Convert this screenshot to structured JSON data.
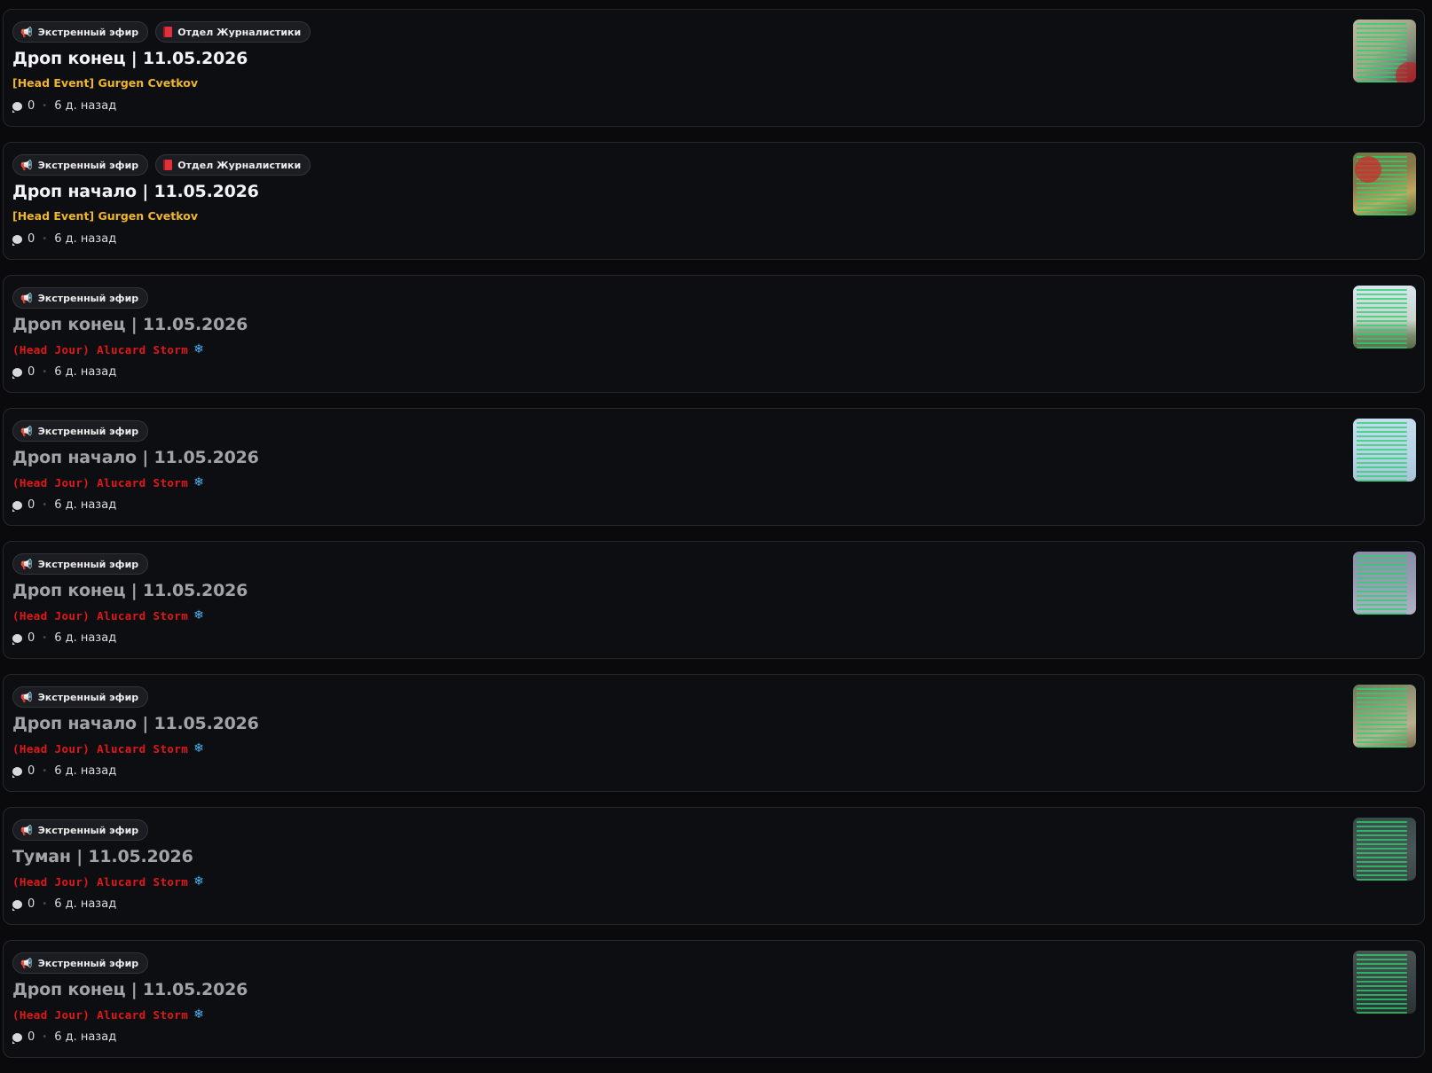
{
  "posts": [
    {
      "tags": [
        {
          "icon": "megaphone-icon",
          "label": "Экстренный эфир"
        },
        {
          "icon": "book-icon",
          "label": "Отдел Журналистики"
        }
      ],
      "title": "Дроп конец | 11.05.2026",
      "read": false,
      "author": "[Head Event] Gurgen Cvetkov",
      "author_style": "head-event",
      "snowflake": false,
      "comments": "0",
      "time": "6 д. назад",
      "thumb": {
        "bg": "linear-gradient(135deg,#b7b69a 0%,#a9a88a 45%,#7b8a7a 70%,#3a2a2a 100%)",
        "accent": "#c2202a"
      }
    },
    {
      "tags": [
        {
          "icon": "megaphone-icon",
          "label": "Экстренный эфир"
        },
        {
          "icon": "book-icon",
          "label": "Отдел Журналистики"
        }
      ],
      "title": "Дроп начало | 11.05.2026",
      "read": false,
      "author": "[Head Event] Gurgen Cvetkov",
      "author_style": "head-event",
      "snowflake": false,
      "comments": "0",
      "time": "6 д. назад",
      "thumb": {
        "bg": "linear-gradient(160deg,#6a7a4a 0%,#8a7a4a 40%,#c0a860 70%,#4a6a3a 100%)",
        "accent": "#d0282a"
      }
    },
    {
      "tags": [
        {
          "icon": "megaphone-icon",
          "label": "Экстренный эфир"
        }
      ],
      "title": "Дроп конец | 11.05.2026",
      "read": true,
      "author": "(Head Jour) Alucard Storm",
      "author_style": "head-jour",
      "snowflake": true,
      "comments": "0",
      "time": "6 д. назад",
      "thumb": {
        "bg": "linear-gradient(180deg,#d9e6ee 0%,#c8d4cc 55%,#7a8a6a 80%,#5a6a4a 100%)",
        "accent": ""
      }
    },
    {
      "tags": [
        {
          "icon": "megaphone-icon",
          "label": "Экстренный эфир"
        }
      ],
      "title": "Дроп начало | 11.05.2026",
      "read": true,
      "author": "(Head Jour) Alucard Storm",
      "author_style": "head-jour",
      "snowflake": true,
      "comments": "0",
      "time": "6 д. назад",
      "thumb": {
        "bg": "linear-gradient(180deg,#c5dcec 0%,#b8d2e6 60%,#a8c2d6 100%)",
        "accent": ""
      }
    },
    {
      "tags": [
        {
          "icon": "megaphone-icon",
          "label": "Экстренный эфир"
        }
      ],
      "title": "Дроп конец | 11.05.2026",
      "read": true,
      "author": "(Head Jour) Alucard Storm",
      "author_style": "head-jour",
      "snowflake": true,
      "comments": "0",
      "time": "6 д. назад",
      "thumb": {
        "bg": "linear-gradient(180deg,#8a8ea8 0%,#9a9cb4 50%,#b0b2c6 100%)",
        "accent": ""
      }
    },
    {
      "tags": [
        {
          "icon": "megaphone-icon",
          "label": "Экстренный эфир"
        }
      ],
      "title": "Дроп начало | 11.05.2026",
      "read": true,
      "author": "(Head Jour) Alucard Storm",
      "author_style": "head-jour",
      "snowflake": true,
      "comments": "0",
      "time": "6 д. назад",
      "thumb": {
        "bg": "linear-gradient(160deg,#6a7a5a 0%,#9a9a7a 40%,#b8b090 70%,#7a7050 100%)",
        "accent": ""
      }
    },
    {
      "tags": [
        {
          "icon": "megaphone-icon",
          "label": "Экстренный эфир"
        }
      ],
      "title": "Туман | 11.05.2026",
      "read": true,
      "author": "(Head Jour) Alucard Storm",
      "author_style": "head-jour",
      "snowflake": true,
      "comments": "0",
      "time": "6 д. назад",
      "thumb": {
        "bg": "linear-gradient(180deg,#3a4a4a 0%,#4a5656 50%,#3c4848 100%)",
        "accent": ""
      }
    },
    {
      "tags": [
        {
          "icon": "megaphone-icon",
          "label": "Экстренный эфир"
        }
      ],
      "title": "Дроп конец | 11.05.2026",
      "read": true,
      "author": "(Head Jour) Alucard Storm",
      "author_style": "head-jour",
      "snowflake": true,
      "comments": "0",
      "time": "6 д. назад",
      "thumb": {
        "bg": "linear-gradient(180deg,#4a5252 0%,#3a4444 50%,#2a3232 100%)",
        "accent": ""
      }
    }
  ]
}
